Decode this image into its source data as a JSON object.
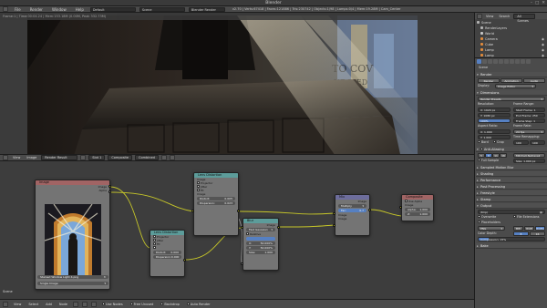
{
  "window": {
    "title": "Blender",
    "controls": [
      "–",
      "□",
      "✕"
    ]
  },
  "infobar": {
    "menus": [
      "File",
      "Render",
      "Window",
      "Help"
    ],
    "screen": "Default",
    "scene": "Scene",
    "engine": "Blender Render",
    "stats": "v2.70 | Verts:67418 | Faces:121886 | Tris:230742 | Objects:1/98 | Lamps:0/4 | Mem:19.28M | Cam_Center"
  },
  "render_view": {
    "header": "Frame:1 | Time:00:04.24 | Mem:153.18M (0.00M, Peak 332.73M)"
  },
  "node_editor": {
    "header": {
      "menus": [
        "View",
        "Image"
      ],
      "image_select": "Render Result",
      "slot": "Slot 1",
      "layer": "Composite",
      "pass": "Combined"
    },
    "nodes": {
      "render_layers": {
        "title": "Render Layers",
        "outputs": [
          "Image",
          "Alpha",
          "Z"
        ],
        "scene_select": "Scene",
        "layer_select": "RenderLayer"
      },
      "image": {
        "title": "Image",
        "outputs": [
          "Image",
          "Alpha"
        ],
        "file": "Stained Window Light 4.png",
        "source": "Single Image"
      },
      "lens_dist_1": {
        "title": "Lens Distortion",
        "rows": [
          "Projector",
          "Jitter",
          "Fit",
          "Image"
        ],
        "fields": [
          {
            "label": "Distort:",
            "value": "0.005"
          },
          {
            "label": "Dispersion:",
            "value": "0.023"
          }
        ]
      },
      "lens_dist_2": {
        "title": "Lens Distortion",
        "rows": [
          "Projector",
          "Jitter",
          "Fit",
          "Image"
        ],
        "fields": [
          {
            "label": "Distort:",
            "value": "0.000"
          },
          {
            "label": "Dispersion:",
            "value": "0.000"
          }
        ]
      },
      "blur": {
        "title": "Blur",
        "rows": [
          "Image"
        ],
        "filter": "Fast Gaussian",
        "relative": "Relative",
        "fields": [
          {
            "label": "X:",
            "value": "50.000%"
          },
          {
            "label": "Y:",
            "value": "50.000%"
          },
          {
            "label": "Size:",
            "value": "1.000"
          }
        ]
      },
      "mix": {
        "title": "Mix",
        "rows": [
          "Image"
        ],
        "mode": "Multiply",
        "fields": [
          {
            "label": "Fac:",
            "value": "0.7"
          }
        ]
      },
      "composite": {
        "title": "Composite",
        "use_alpha": "Use Alpha",
        "rows": [
          "Image"
        ],
        "fields": [
          {
            "label": "Alpha:",
            "value": "1.000"
          },
          {
            "label": "Z:",
            "value": "1.000"
          }
        ]
      }
    },
    "status": "Scene"
  },
  "footer": {
    "items": [
      "View",
      "Select",
      "Add",
      "Node",
      "Use Nodes",
      "Free Unused",
      "Backdrop",
      "Auto Render"
    ]
  },
  "outliner": {
    "header": [
      "View",
      "Search",
      "All Scenes"
    ],
    "items": [
      {
        "label": "Scene",
        "color": "#b3b3b3"
      },
      {
        "label": "RenderLayers",
        "color": "#b3b3b3"
      },
      {
        "label": "World",
        "color": "#c7c7c7"
      },
      {
        "label": "Camera",
        "color": "#e08a3c"
      },
      {
        "label": "Cube",
        "color": "#e08a3c"
      },
      {
        "label": "Lamp",
        "color": "#e08a3c"
      },
      {
        "label": "Lamp",
        "color": "#e08a3c"
      }
    ]
  },
  "properties": {
    "scene_name": "Scene",
    "render_section": "Render",
    "render_buttons": [
      "Render",
      "Animation",
      "Audio"
    ],
    "display_label": "Display:",
    "display_value": "Image Editor",
    "dimensions": "Dimensions",
    "presets": "Render Presets",
    "resolution_label": "Resolution:",
    "res_x": "X: 1920 px",
    "res_y": "Y: 1080 px",
    "res_pct": "100%",
    "frame_range_label": "Frame Range:",
    "start_frame": "Start Frame: 1",
    "end_frame": "End Frame: 250",
    "frame_step": "Frame Step: 1",
    "aspect_label": "Aspect Ratio:",
    "aspect_x": "X: 1.000",
    "aspect_y": "Y: 1.000",
    "frame_rate_label": "Frame Rate:",
    "fps": "24 fps",
    "time_remap": "Time Remapping:",
    "old": "100",
    "new": "100",
    "border": "Bord",
    "crop": "Crop",
    "aa": "Anti-Aliasing",
    "aa_vals": [
      "5",
      "8",
      "11",
      "16"
    ],
    "aa_filter": "Mitchell-Netravali",
    "full_sample": "Full Sample",
    "size_field": "Size: 1.000 px",
    "collapsed": [
      "Sampled Motion Blur",
      "Shading",
      "Performance",
      "Post Processing",
      "Freestyle",
      "Stamp"
    ],
    "output": "Output",
    "output_path": "/tmp/",
    "overwrite": "Overwrite",
    "file_ext": "File Extensions",
    "placeholders": "Placeholders",
    "format": "PNG",
    "color_modes": [
      "BW",
      "RGB",
      "RGBA"
    ],
    "color_depth_label": "Color Depth:",
    "depth_vals": [
      "8",
      "16"
    ],
    "compression": "Compression: 15%",
    "bake": "Bake",
    "accent": "#5680c2"
  }
}
